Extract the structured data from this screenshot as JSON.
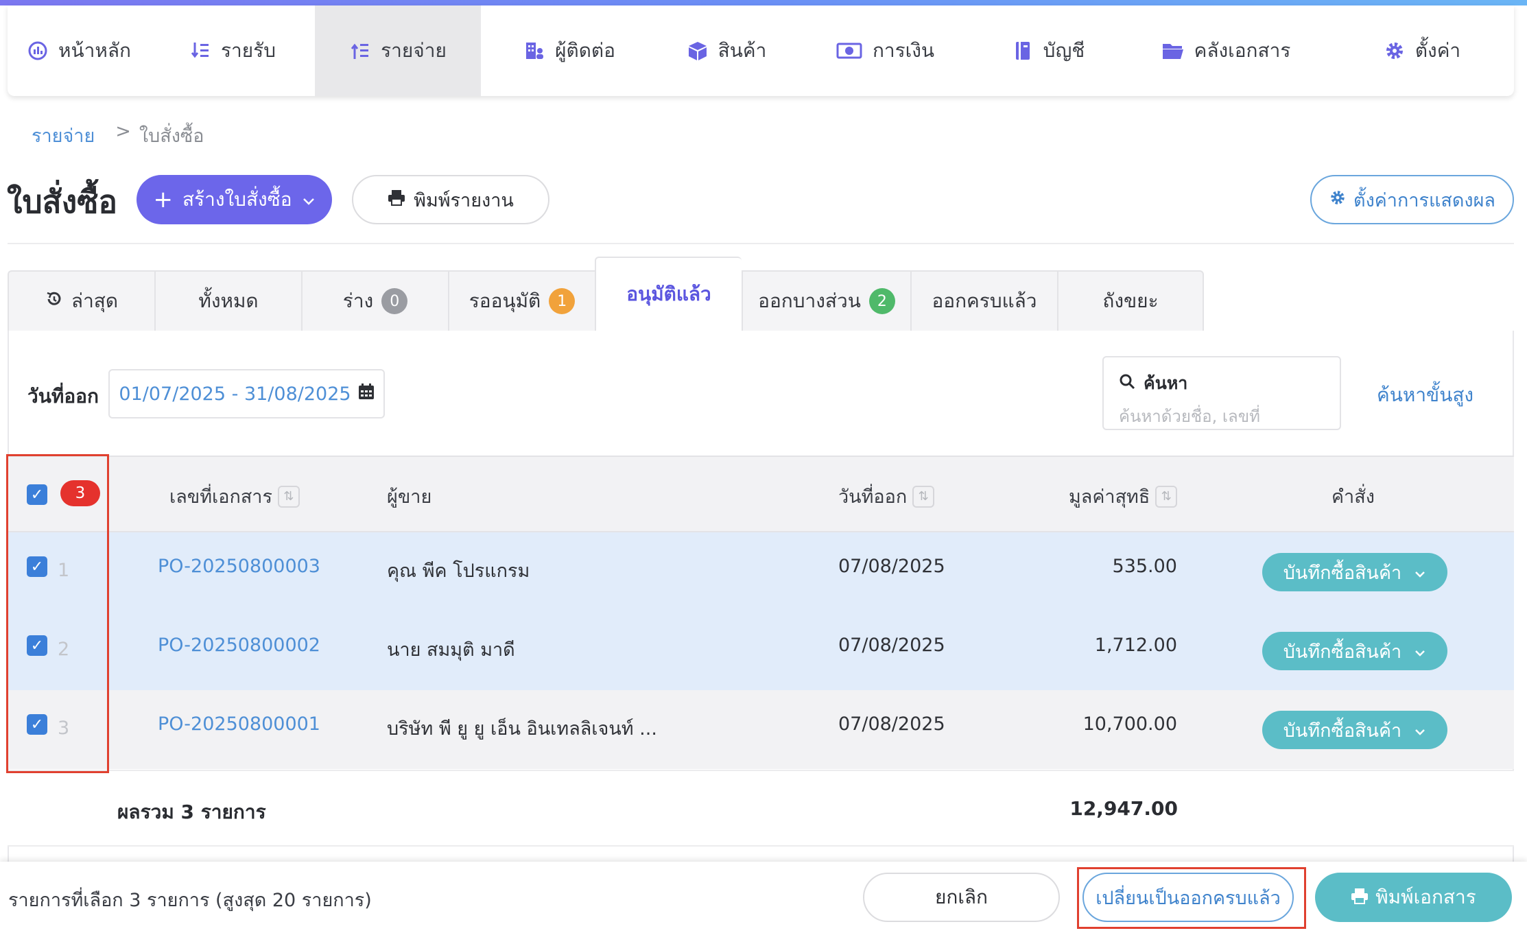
{
  "nav": [
    {
      "label": "หน้าหลัก",
      "icon": "dashboard-icon"
    },
    {
      "label": "รายรับ",
      "icon": "income-icon"
    },
    {
      "label": "รายจ่าย",
      "icon": "expense-icon"
    },
    {
      "label": "ผู้ติดต่อ",
      "icon": "contacts-icon"
    },
    {
      "label": "สินค้า",
      "icon": "box-icon"
    },
    {
      "label": "การเงิน",
      "icon": "money-icon"
    },
    {
      "label": "บัญชี",
      "icon": "book-icon"
    },
    {
      "label": "คลังเอกสาร",
      "icon": "folder-icon"
    },
    {
      "label": "ตั้งค่า",
      "icon": "gear-icon"
    }
  ],
  "breadcrumb": {
    "parent": "รายจ่าย",
    "separator": ">",
    "current": "ใบสั่งซื้อ"
  },
  "page": {
    "title": "ใบสั่งซื้อ",
    "create_label": "สร้างใบสั่งซื้อ",
    "print_report_label": "พิมพ์รายงาน",
    "display_settings_label": "ตั้งค่าการแสดงผล"
  },
  "tabs": [
    {
      "label": "ล่าสุด"
    },
    {
      "label": "ทั้งหมด"
    },
    {
      "label": "ร่าง",
      "badge": "0"
    },
    {
      "label": "รออนุมัติ",
      "badge": "1"
    },
    {
      "label": "อนุมัติแล้ว"
    },
    {
      "label": "ออกบางส่วน",
      "badge": "2"
    },
    {
      "label": "ออกครบแล้ว"
    },
    {
      "label": "ถังขยะ"
    }
  ],
  "filter": {
    "label": "วันที่ออก",
    "date_range": "01/07/2025 - 31/08/2025"
  },
  "search": {
    "title": "ค้นหา",
    "placeholder": "ค้นหาด้วยชื่อ, เลขที่",
    "advanced_label": "ค้นหาขั้นสูง"
  },
  "table": {
    "selected_count": "3",
    "headers": {
      "doc_no": "เลขที่เอกสาร",
      "vendor": "ผู้ขาย",
      "issue_date": "วันที่ออก",
      "net_value": "มูลค่าสุทธิ",
      "command": "คำสั่ง"
    },
    "rows": [
      {
        "num": "1",
        "doc_no": "PO-20250800003",
        "vendor": "คุณ พีค โปรแกรม",
        "date": "07/08/2025",
        "amount": "535.00",
        "action": "บันทึกซื้อสินค้า"
      },
      {
        "num": "2",
        "doc_no": "PO-20250800002",
        "vendor": "นาย สมมุติ มาดี",
        "date": "07/08/2025",
        "amount": "1,712.00",
        "action": "บันทึกซื้อสินค้า"
      },
      {
        "num": "3",
        "doc_no": "PO-20250800001",
        "vendor": "บริษัท พี ยู ยู เอ็น อินเทลลิเจนท์ ...",
        "date": "07/08/2025",
        "amount": "10,700.00",
        "action": "บันทึกซื้อสินค้า"
      }
    ],
    "total_label": "ผลรวม 3 รายการ",
    "total_value": "12,947.00"
  },
  "bottom_bar": {
    "selection_text": "รายการที่เลือก 3 รายการ (สูงสุด 20 รายการ)",
    "cancel_label": "ยกเลิก",
    "convert_label": "เปลี่ยนเป็นออกครบแล้ว",
    "print_label": "พิมพ์เอกสาร"
  },
  "colors": {
    "primary": "#6c66ea",
    "teal": "#5bbdc7",
    "link": "#4e8fd6",
    "highlight": "#e0402f",
    "selected_row": "#e1ecfa"
  }
}
